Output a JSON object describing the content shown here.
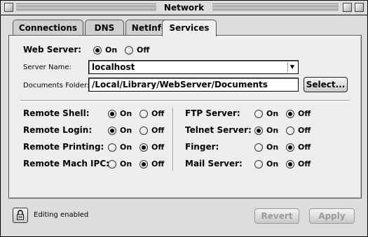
{
  "window": {
    "title": "Network"
  },
  "tabs": [
    {
      "label": "Connections"
    },
    {
      "label": "DNS"
    },
    {
      "label": "NetInfo"
    },
    {
      "label": "Services"
    }
  ],
  "active_tab": "Services",
  "web_server": {
    "label": "Web Server:",
    "on_label": "On",
    "off_label": "Off",
    "selected": "On",
    "server_name_label": "Server Name:",
    "server_name_value": "localhost",
    "docs_folder_label": "Documents Folder:",
    "docs_folder_value": "/Local/Library/WebServer/Documents",
    "select_button": "Select..."
  },
  "services_left": [
    {
      "label": "Remote Shell:",
      "selected": "On"
    },
    {
      "label": "Remote Login:",
      "selected": "On"
    },
    {
      "label": "Remote Printing:",
      "selected": "Off"
    },
    {
      "label": "Remote Mach IPC:",
      "selected": "Off"
    }
  ],
  "services_right": [
    {
      "label": "FTP Server:",
      "selected": "Off"
    },
    {
      "label": "Telnet Server:",
      "selected": "On"
    },
    {
      "label": "Finger:",
      "selected": "Off"
    },
    {
      "label": "Mail Server:",
      "selected": "Off"
    }
  ],
  "radio_on": "On",
  "radio_off": "Off",
  "footer": {
    "status": "Editing enabled",
    "revert_button": "Revert",
    "apply_button": "Apply"
  },
  "icons": {
    "lock": "lock-icon",
    "dropdown": "chevron-down-icon"
  }
}
